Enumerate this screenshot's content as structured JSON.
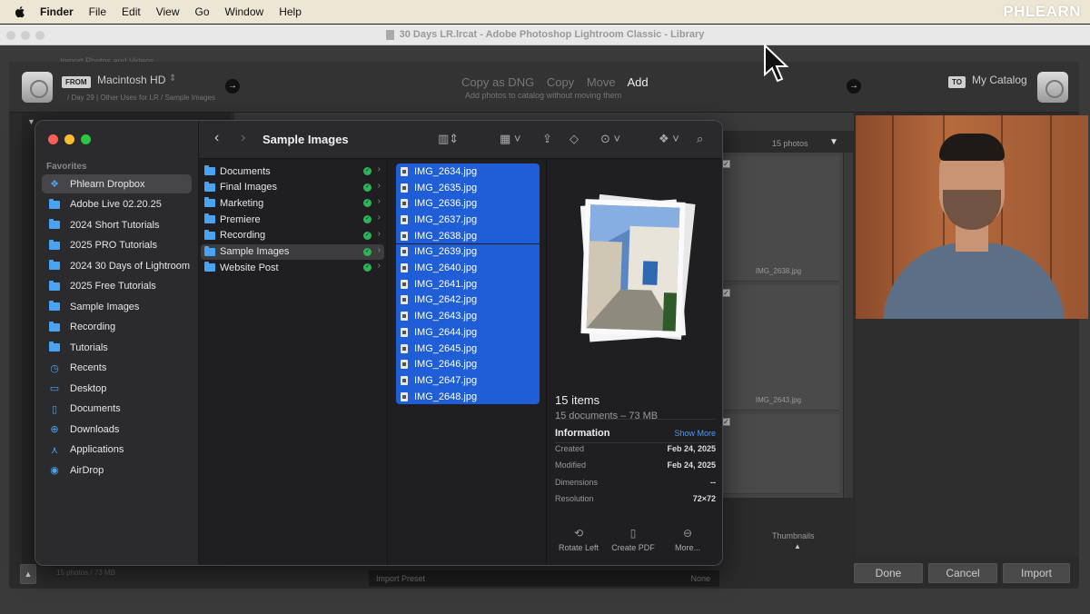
{
  "menubar": {
    "items": [
      "Finder",
      "File",
      "Edit",
      "View",
      "Go",
      "Window",
      "Help"
    ],
    "brand": "PHLEARN"
  },
  "lr": {
    "window_title": "30 Days LR.lrcat - Adobe Photoshop Lightroom Classic - Library",
    "hint": "Import Photos and Videos",
    "from_tag": "FROM",
    "from_source": "Macintosh HD",
    "from_path": "/ Day 29 | Other Uses for LR / Sample Images",
    "modes": [
      "Copy as DNG",
      "Copy",
      "Move",
      "Add"
    ],
    "mode_sub": "Add photos to catalog without moving them",
    "to_tag": "TO",
    "to_dest": "My Catalog",
    "grid_count": "15 photos",
    "grid_files": [
      "IMG_2638.jpg",
      "IMG_2643.jpg"
    ],
    "thumbnails_label": "Thumbnails",
    "footer_info": "15 photos / 73 MB",
    "preset_label": "Import Preset",
    "preset_value": "None",
    "buttons": {
      "done": "Done",
      "cancel": "Cancel",
      "import": "Import"
    }
  },
  "finder": {
    "title": "Sample Images",
    "favorites_label": "Favorites",
    "sidebar": [
      {
        "label": "Phlearn Dropbox",
        "icon": "dropbox-icon"
      },
      {
        "label": "Adobe Live 02.20.25",
        "icon": "folder-icon"
      },
      {
        "label": "2024 Short Tutorials",
        "icon": "folder-icon"
      },
      {
        "label": "2025 PRO Tutorials",
        "icon": "folder-icon"
      },
      {
        "label": "2024 30 Days of Lightroom",
        "icon": "folder-icon"
      },
      {
        "label": "2025 Free Tutorials",
        "icon": "folder-icon"
      },
      {
        "label": "Sample Images",
        "icon": "folder-icon"
      },
      {
        "label": "Recording",
        "icon": "folder-icon"
      },
      {
        "label": "Tutorials",
        "icon": "folder-icon"
      },
      {
        "label": "Recents",
        "icon": "clock-icon"
      },
      {
        "label": "Desktop",
        "icon": "desktop-icon"
      },
      {
        "label": "Documents",
        "icon": "document-icon"
      },
      {
        "label": "Downloads",
        "icon": "download-icon"
      },
      {
        "label": "Applications",
        "icon": "applications-icon"
      },
      {
        "label": "AirDrop",
        "icon": "airdrop-icon"
      }
    ],
    "folders": [
      "Documents",
      "Final Images",
      "Marketing",
      "Premiere",
      "Recording",
      "Sample Images",
      "Website Post"
    ],
    "files": [
      "IMG_2634.jpg",
      "IMG_2635.jpg",
      "IMG_2636.jpg",
      "IMG_2637.jpg",
      "IMG_2638.jpg",
      "IMG_2639.jpg",
      "IMG_2640.jpg",
      "IMG_2641.jpg",
      "IMG_2642.jpg",
      "IMG_2643.jpg",
      "IMG_2644.jpg",
      "IMG_2645.jpg",
      "IMG_2646.jpg",
      "IMG_2647.jpg",
      "IMG_2648.jpg"
    ],
    "preview": {
      "count": "15 items",
      "sub": "15 documents – 73 MB",
      "info_label": "Information",
      "show_more": "Show More",
      "meta": [
        {
          "k": "Created",
          "v": "Feb 24, 2025"
        },
        {
          "k": "Modified",
          "v": "Feb 24, 2025"
        },
        {
          "k": "Dimensions",
          "v": "--"
        },
        {
          "k": "Resolution",
          "v": "72×72"
        }
      ],
      "actions": [
        "Rotate Left",
        "Create PDF",
        "More..."
      ]
    }
  },
  "colors": {
    "selection": "#1f5ed6",
    "sync_green": "#2fb35a",
    "folder_blue": "#4aa3f0",
    "link_blue": "#4c9bf5"
  }
}
